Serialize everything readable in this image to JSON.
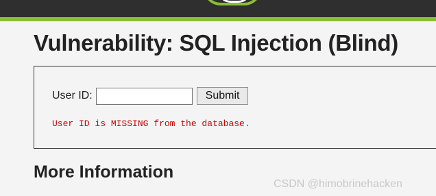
{
  "header": {
    "logo_icon": "dvwa-logo-icon",
    "accent_color": "#8bbf33",
    "bar_color": "#2f2f2f"
  },
  "page": {
    "title": "Vulnerability: SQL Injection (Blind)"
  },
  "form": {
    "user_id_label": "User ID:",
    "user_id_value": "",
    "submit_label": "Submit"
  },
  "result": {
    "message": "User ID is MISSING from the database.",
    "color": "#cc0000"
  },
  "more_info": {
    "heading": "More Information"
  },
  "watermark": {
    "text": "CSDN @himobrinehacken"
  }
}
